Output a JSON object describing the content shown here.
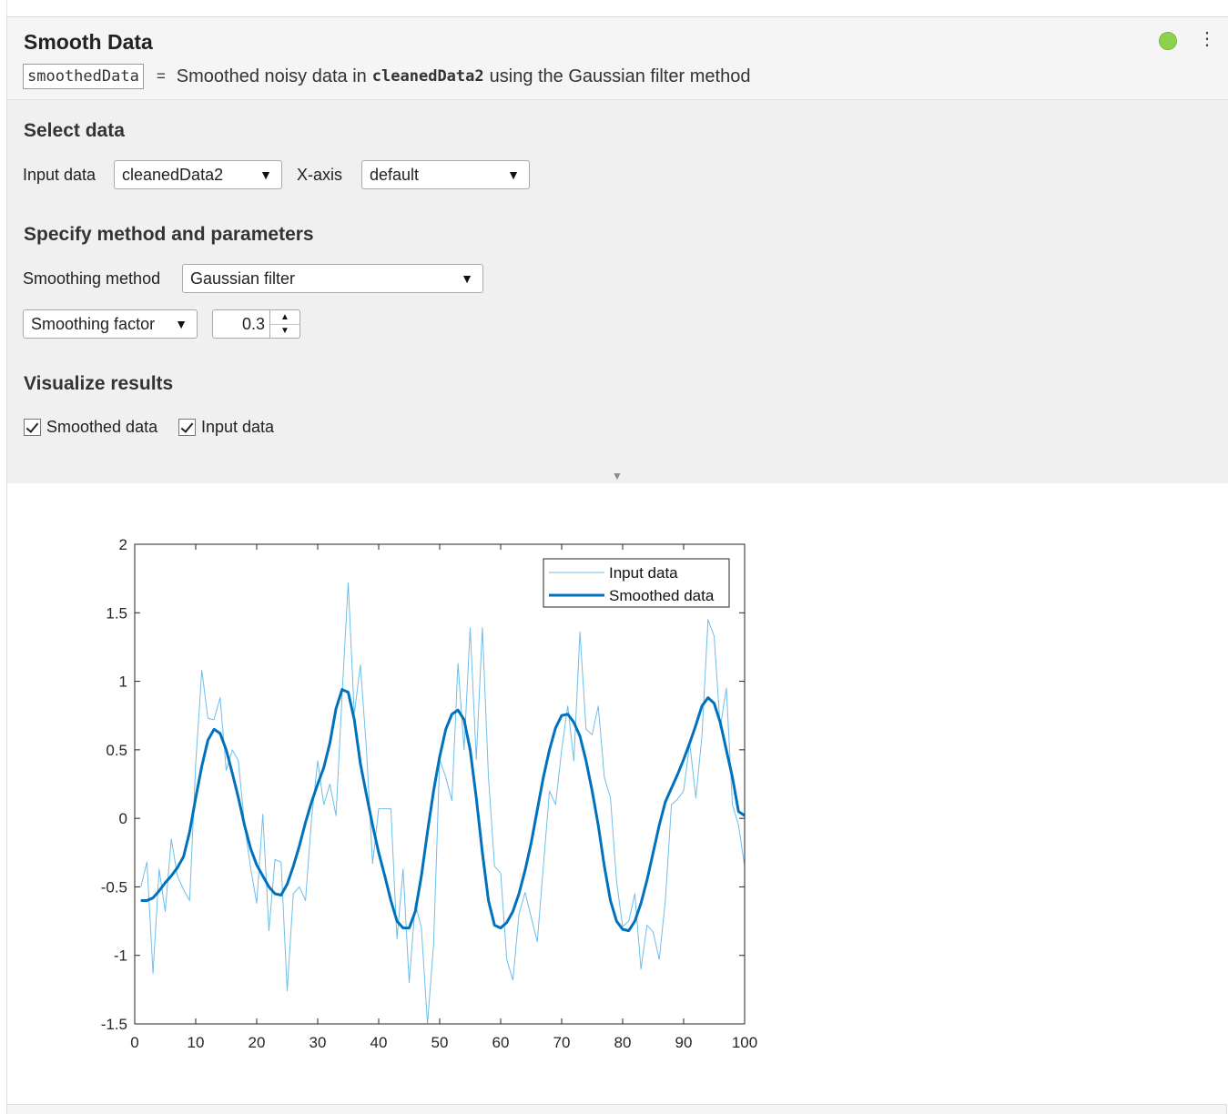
{
  "task": {
    "title": "Smooth Data",
    "output_var": "smoothedData",
    "eq": "=",
    "summary_prefix": "Smoothed noisy data in",
    "summary_input": "cleanedData2",
    "summary_suffix": "using the Gaussian filter method",
    "status_color": "#8fd14f"
  },
  "select_data": {
    "title": "Select data",
    "input_label": "Input data",
    "input_value": "cleanedData2",
    "xaxis_label": "X-axis",
    "xaxis_value": "default"
  },
  "method": {
    "title": "Specify method and parameters",
    "method_label": "Smoothing method",
    "method_value": "Gaussian filter",
    "param_value": "Smoothing factor",
    "param_number": "0.3"
  },
  "visualize": {
    "title": "Visualize results",
    "smoothed_label": "Smoothed data",
    "smoothed_checked": true,
    "input_label": "Input data",
    "input_checked": true
  },
  "chart_data": {
    "type": "line",
    "xlim": [
      0,
      100
    ],
    "ylim": [
      -1.5,
      2
    ],
    "xticks": [
      "0",
      "10",
      "20",
      "30",
      "40",
      "50",
      "60",
      "70",
      "80",
      "90",
      "100"
    ],
    "yticks": [
      "-1.5",
      "-1",
      "-0.5",
      "0",
      "0.5",
      "1",
      "1.5",
      "2"
    ],
    "legend_position": "top-right",
    "series": [
      {
        "name": "Input data",
        "color": "#6fbde8",
        "x": [
          1,
          2,
          3,
          4,
          5,
          6,
          7,
          8,
          9,
          10,
          11,
          12,
          13,
          14,
          15,
          16,
          17,
          18,
          19,
          20,
          21,
          22,
          23,
          24,
          25,
          26,
          27,
          28,
          29,
          30,
          31,
          32,
          33,
          34,
          35,
          36,
          37,
          38,
          39,
          40,
          41,
          42,
          43,
          44,
          45,
          46,
          47,
          48,
          49,
          50,
          51,
          52,
          53,
          54,
          55,
          56,
          57,
          58,
          59,
          60,
          61,
          62,
          63,
          64,
          65,
          66,
          67,
          68,
          69,
          70,
          71,
          72,
          73,
          74,
          75,
          76,
          77,
          78,
          79,
          80,
          81,
          82,
          83,
          84,
          85,
          86,
          87,
          88,
          89,
          90,
          91,
          92,
          93,
          94,
          95,
          96,
          97,
          98,
          99,
          100
        ],
        "y": [
          -0.5,
          -0.32,
          -1.13,
          -0.37,
          -0.68,
          -0.15,
          -0.42,
          -0.52,
          -0.6,
          0.4,
          1.08,
          0.73,
          0.72,
          0.88,
          0.35,
          0.5,
          0.42,
          -0.05,
          -0.36,
          -0.62,
          0.03,
          -0.82,
          -0.3,
          -0.32,
          -1.26,
          -0.55,
          -0.5,
          -0.6,
          0.0,
          0.42,
          0.1,
          0.25,
          0.02,
          0.9,
          1.72,
          0.76,
          1.12,
          0.5,
          -0.33,
          0.07,
          0.07,
          0.07,
          -0.88,
          -0.37,
          -1.2,
          -0.62,
          -0.8,
          -1.5,
          -0.92,
          0.43,
          0.3,
          0.13,
          1.13,
          0.5,
          1.39,
          0.43,
          1.39,
          0.3,
          -0.35,
          -0.4,
          -1.03,
          -1.18,
          -0.7,
          -0.54,
          -0.72,
          -0.9,
          -0.35,
          0.2,
          0.1,
          0.5,
          0.82,
          0.42,
          1.36,
          0.65,
          0.61,
          0.82,
          0.3,
          0.15,
          -0.46,
          -0.79,
          -0.75,
          -0.55,
          -1.1,
          -0.78,
          -0.83,
          -1.03,
          -0.6,
          0.1,
          0.14,
          0.2,
          0.55,
          0.15,
          0.6,
          1.45,
          1.33,
          0.66,
          0.95,
          0.1,
          -0.05,
          -0.35
        ]
      },
      {
        "name": "Smoothed data",
        "color": "#0072bd",
        "x": [
          1,
          2,
          3,
          4,
          5,
          6,
          7,
          8,
          9,
          10,
          11,
          12,
          13,
          14,
          15,
          16,
          17,
          18,
          19,
          20,
          21,
          22,
          23,
          24,
          25,
          26,
          27,
          28,
          29,
          30,
          31,
          32,
          33,
          34,
          35,
          36,
          37,
          38,
          39,
          40,
          41,
          42,
          43,
          44,
          45,
          46,
          47,
          48,
          49,
          50,
          51,
          52,
          53,
          54,
          55,
          56,
          57,
          58,
          59,
          60,
          61,
          62,
          63,
          64,
          65,
          66,
          67,
          68,
          69,
          70,
          71,
          72,
          73,
          74,
          75,
          76,
          77,
          78,
          79,
          80,
          81,
          82,
          83,
          84,
          85,
          86,
          87,
          88,
          89,
          90,
          91,
          92,
          93,
          94,
          95,
          96,
          97,
          98,
          99,
          100
        ],
        "y": [
          -0.6,
          -0.6,
          -0.58,
          -0.53,
          -0.47,
          -0.42,
          -0.36,
          -0.28,
          -0.1,
          0.15,
          0.38,
          0.57,
          0.65,
          0.62,
          0.5,
          0.33,
          0.15,
          -0.05,
          -0.22,
          -0.34,
          -0.42,
          -0.5,
          -0.55,
          -0.56,
          -0.48,
          -0.35,
          -0.2,
          -0.03,
          0.12,
          0.25,
          0.37,
          0.55,
          0.8,
          0.94,
          0.92,
          0.72,
          0.4,
          0.17,
          -0.05,
          -0.25,
          -0.42,
          -0.6,
          -0.75,
          -0.8,
          -0.8,
          -0.68,
          -0.42,
          -0.1,
          0.2,
          0.45,
          0.65,
          0.76,
          0.79,
          0.72,
          0.5,
          0.15,
          -0.25,
          -0.6,
          -0.78,
          -0.8,
          -0.76,
          -0.68,
          -0.55,
          -0.38,
          -0.18,
          0.06,
          0.3,
          0.5,
          0.66,
          0.75,
          0.76,
          0.7,
          0.6,
          0.42,
          0.2,
          -0.05,
          -0.35,
          -0.6,
          -0.75,
          -0.81,
          -0.82,
          -0.75,
          -0.62,
          -0.45,
          -0.25,
          -0.05,
          0.12,
          0.22,
          0.32,
          0.43,
          0.55,
          0.68,
          0.82,
          0.88,
          0.84,
          0.7,
          0.5,
          0.3,
          0.05,
          0.02
        ]
      }
    ]
  }
}
